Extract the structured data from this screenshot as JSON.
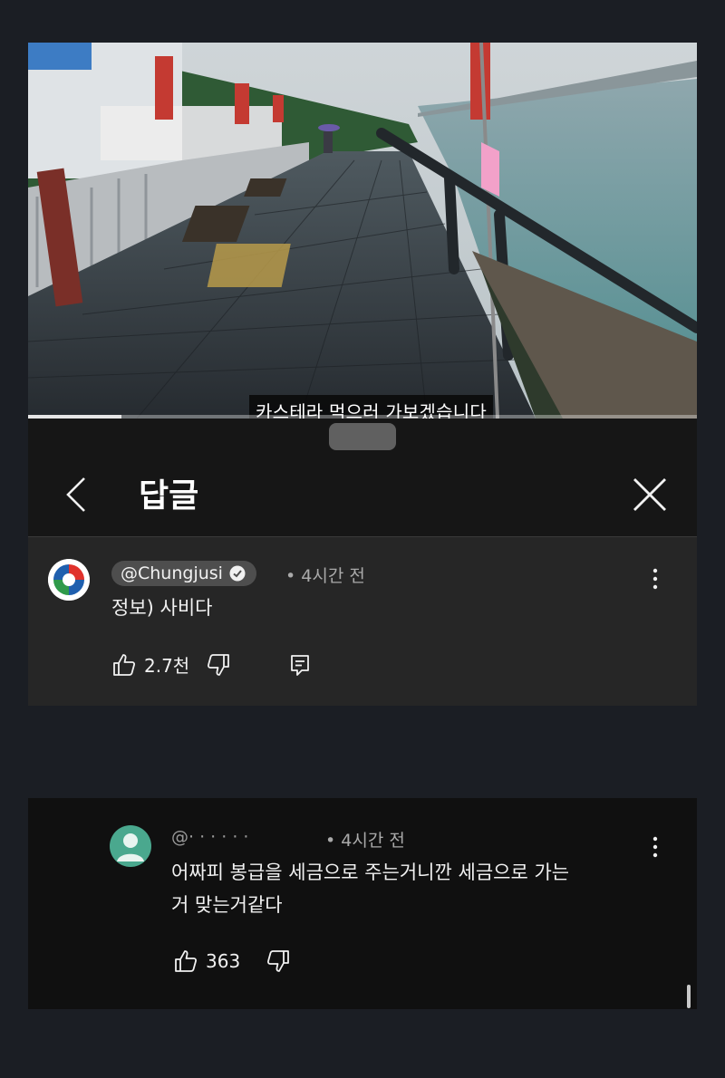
{
  "video": {
    "subtitle": "카스테라 먹으러 가보겠습니다",
    "progress": 0.14
  },
  "sheet": {
    "title": "답글"
  },
  "comment": {
    "author": "@Chungjusi",
    "verified": true,
    "time": "• 4시간 전",
    "text": "정보) 사비다",
    "likes": "2.7천"
  },
  "reply": {
    "author": "@·  ·  ·  ·  ·  ·",
    "time": "• 4시간 전",
    "text_line1": "어짜피 봉급을 세금으로 주는거니깐 세금으로 가는",
    "text_line2": "거 맞는거같다",
    "likes": "363"
  },
  "colors": {
    "background": "#1b1e24",
    "sheet": "#161616",
    "card": "#262626",
    "chip": "#4e4e4e",
    "avatar_reply": "#4aa88e"
  },
  "icons": [
    "chevron-left-icon",
    "close-icon",
    "kebab-menu-icon",
    "thumbs-up-icon",
    "thumbs-down-icon",
    "reply-icon",
    "verified-check-icon"
  ]
}
